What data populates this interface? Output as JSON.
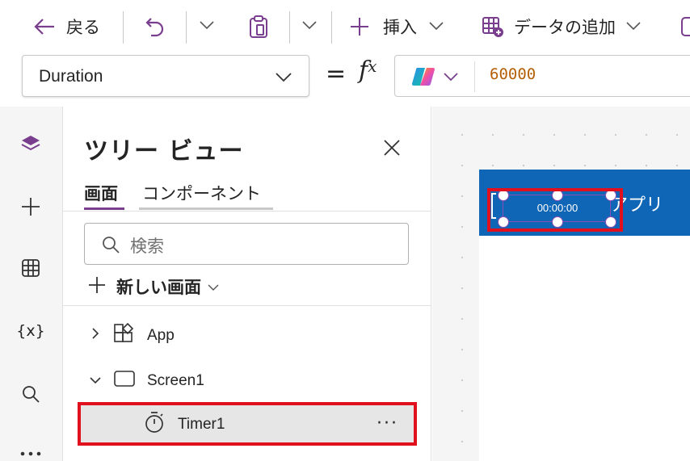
{
  "toolbar": {
    "back_label": "戻る",
    "insert_label": "挿入",
    "add_data_label": "データの追加"
  },
  "formula_bar": {
    "property": "Duration",
    "value": "60000"
  },
  "tree_panel": {
    "title": "ツリー ビュー",
    "tabs": [
      {
        "label": "画面"
      },
      {
        "label": "コンポーネント"
      }
    ],
    "search_placeholder": "検索",
    "new_screen_label": "新しい画面",
    "nodes": [
      {
        "label": "App"
      },
      {
        "label": "Screen1"
      },
      {
        "label": "Timer1"
      }
    ]
  },
  "canvas": {
    "header_title": "アプリ",
    "timer_text": "00:00:00"
  },
  "colors": {
    "accent": "#7a3e8e",
    "header_blue": "#0f66b6",
    "annotation_red": "#e0101e",
    "formula_value": "#b45f06"
  }
}
